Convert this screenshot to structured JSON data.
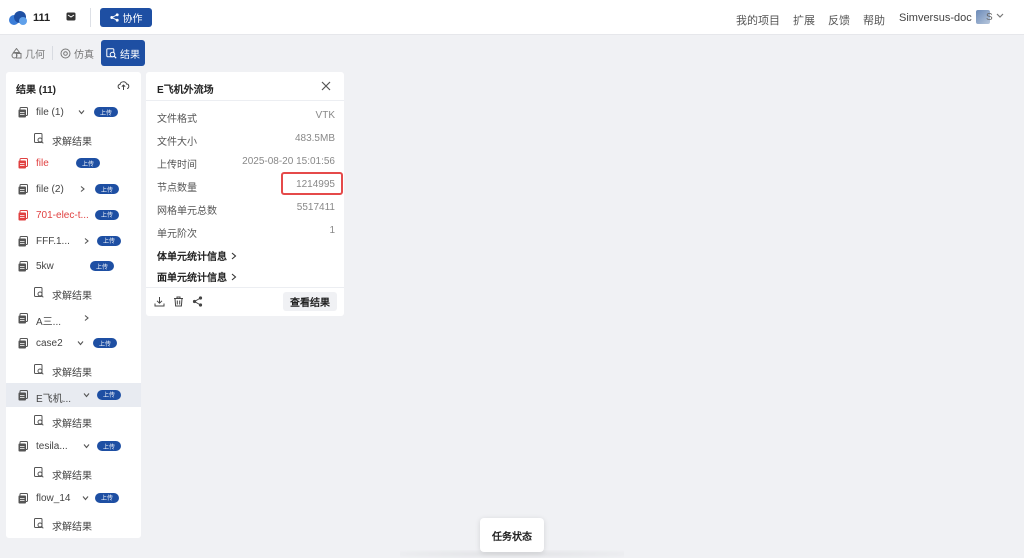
{
  "colors": {
    "accent": "#1e4fa3",
    "danger": "#e04040",
    "highlight": "#e54a4a"
  },
  "header": {
    "project_name": "111",
    "collab_label": "协作",
    "nav": {
      "my_projects": "我的项目",
      "extensions": "扩展",
      "feedback": "反馈",
      "help": "帮助",
      "user": "Simversus-doc",
      "avatar_text": "S"
    }
  },
  "tabs": [
    {
      "label": "几何",
      "icon": "geometry-icon"
    },
    {
      "label": "仿真",
      "icon": "simulation-icon"
    },
    {
      "label": "结果",
      "icon": "results-search-icon",
      "active": true
    }
  ],
  "results": {
    "title": "结果 (11)",
    "items": [
      {
        "label": "file (1)",
        "badge": "上传",
        "expanded": true
      },
      {
        "label": "求解结果",
        "child": true
      },
      {
        "label": "file",
        "badge": "上传",
        "error": true
      },
      {
        "label": "file (2)",
        "badge": "上传",
        "expanded": false
      },
      {
        "label": "701-elec-t...",
        "badge": "上传",
        "error": true
      },
      {
        "label": "FFF.1...",
        "badge": "上传",
        "expanded": false
      },
      {
        "label": "5kw",
        "badge": "上传"
      },
      {
        "label": "求解结果",
        "child": true
      },
      {
        "label": "A三...",
        "badge": "上传",
        "expanded": false
      },
      {
        "label": "case2",
        "badge": "上传",
        "expanded": true
      },
      {
        "label": "求解结果",
        "child": true
      },
      {
        "label": "E飞机...",
        "badge": "上传",
        "expanded": true,
        "selected": true
      },
      {
        "label": "求解结果",
        "child": true
      },
      {
        "label": "tesila...",
        "badge": "上传",
        "expanded": true
      },
      {
        "label": "求解结果",
        "child": true
      },
      {
        "label": "flow_14",
        "badge": "上传",
        "expanded": true
      },
      {
        "label": "求解结果",
        "child": true
      }
    ]
  },
  "detail": {
    "title": "E飞机外流场",
    "fields": [
      {
        "key": "文件格式",
        "value": "VTK"
      },
      {
        "key": "文件大小",
        "value": "483.5MB"
      },
      {
        "key": "上传时间",
        "value": "2025-08-20 15:01:56"
      },
      {
        "key": "节点数量",
        "value": "1214995"
      },
      {
        "key": "网格单元总数",
        "value": "5517411"
      },
      {
        "key": "单元阶次",
        "value": "1"
      }
    ],
    "sections": {
      "volume": "体单元统计信息",
      "surface": "面单元统计信息"
    },
    "view_label": "查看结果"
  },
  "task_status": "任务状态"
}
